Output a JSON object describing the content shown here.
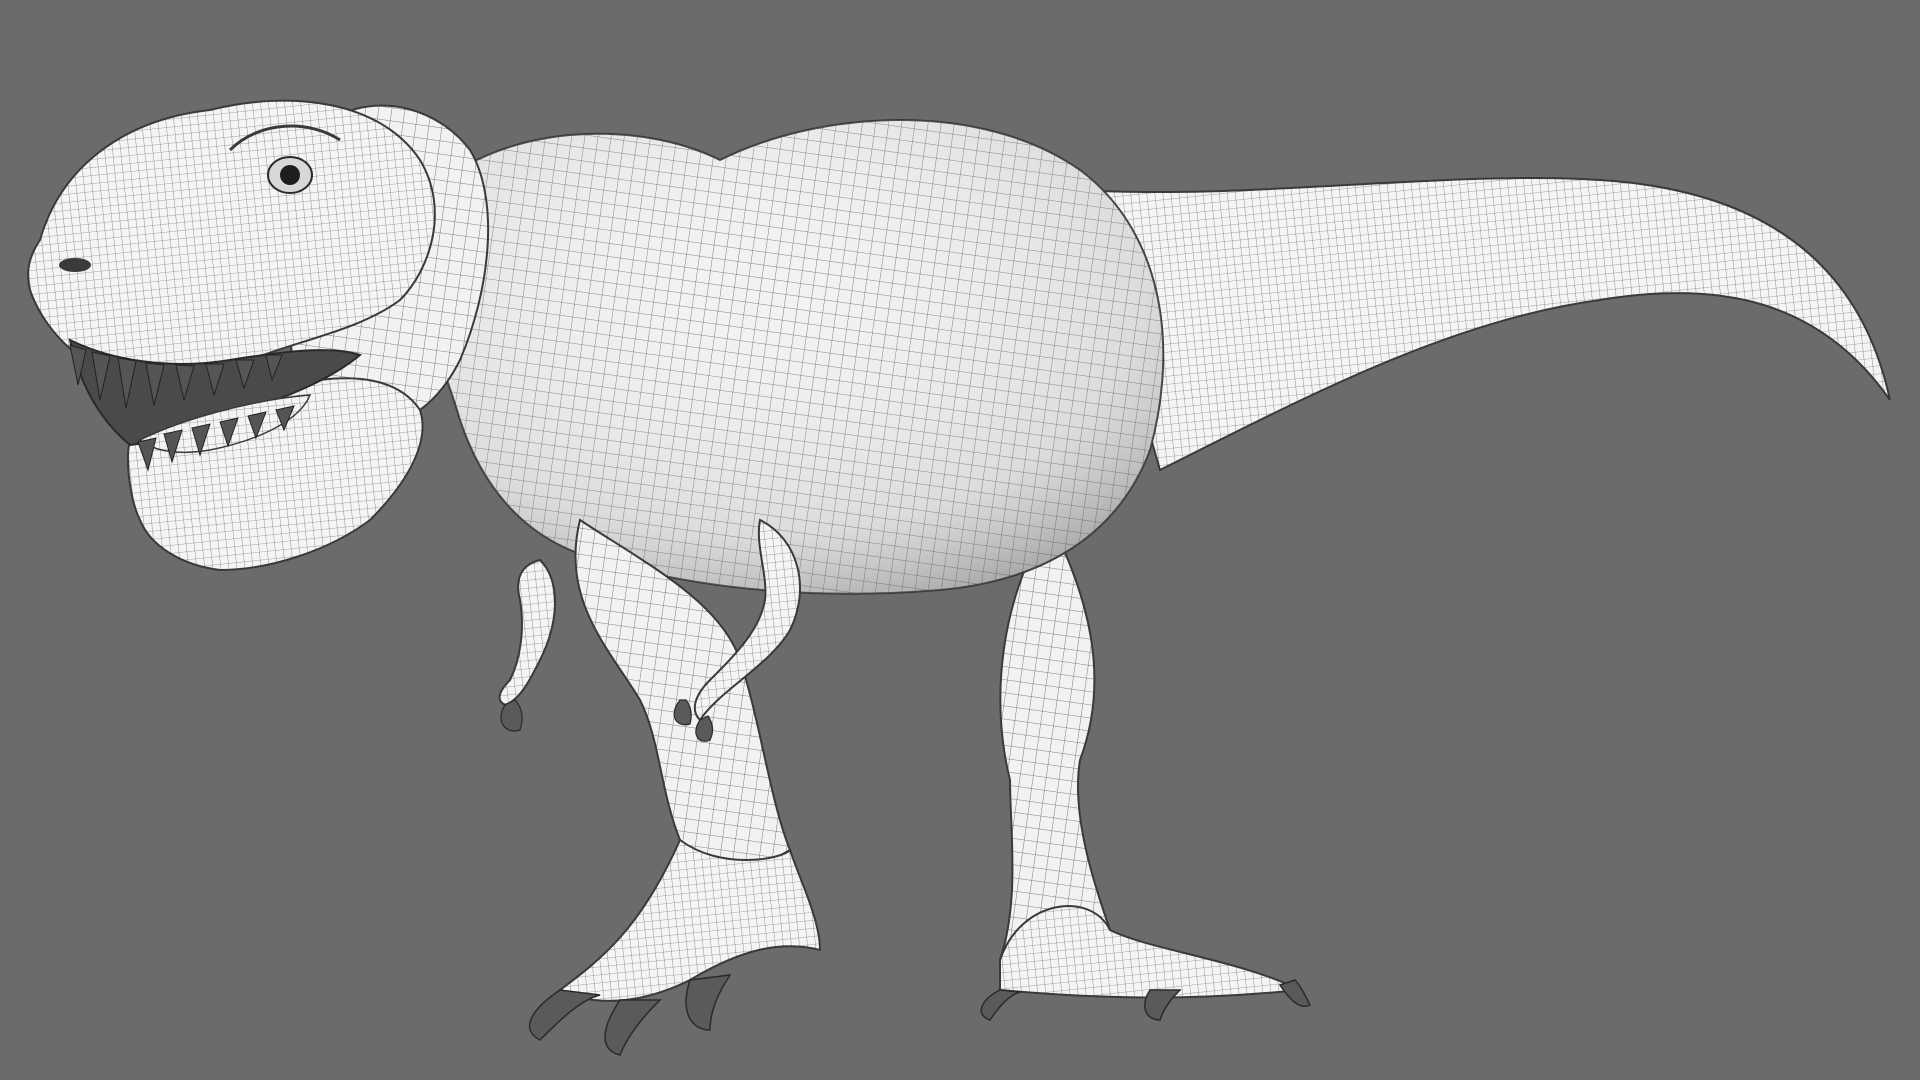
{
  "viewport": {
    "background_color": "#6b6b6b",
    "model_fill_color": "#f2f2f2",
    "wire_color": "#2a2a2a",
    "shadow_color": "#3a3a3a",
    "subject": "trex-wireframe-model"
  }
}
